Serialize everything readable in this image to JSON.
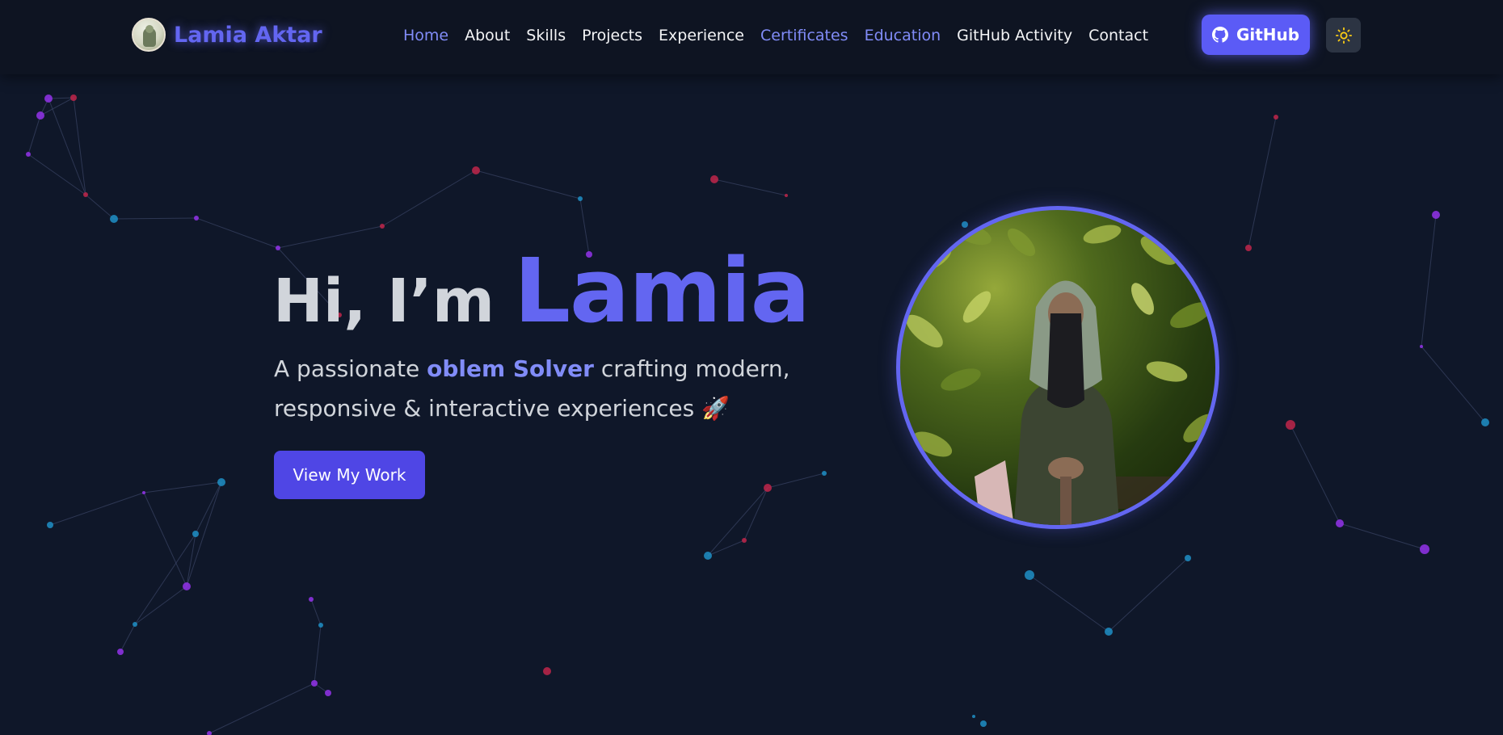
{
  "brand": {
    "name": "Lamia Aktar",
    "avatar_icon": "profile-avatar"
  },
  "nav": {
    "items": [
      {
        "label": "Home",
        "active": true
      },
      {
        "label": "About",
        "active": false
      },
      {
        "label": "Skills",
        "active": false
      },
      {
        "label": "Projects",
        "active": false
      },
      {
        "label": "Experience",
        "active": false
      },
      {
        "label": "Certificates",
        "active": true
      },
      {
        "label": "Education",
        "active": true
      },
      {
        "label": "GitHub Activity",
        "active": false
      },
      {
        "label": "Contact",
        "active": false
      }
    ],
    "github_button": {
      "label": "GitHub",
      "icon": "github-icon"
    },
    "theme_toggle": {
      "icon": "sun-icon"
    }
  },
  "hero": {
    "greeting": "Hi, I’m",
    "name": "Lamia",
    "tagline_prefix": "A passionate ",
    "tagline_highlight": "oblem Solver",
    "tagline_suffix": " crafting modern, responsive & interactive experiences ",
    "tagline_emoji": "🚀",
    "cta_label": "View My Work",
    "photo_icon": "profile-photo"
  },
  "colors": {
    "background": "#0f1729",
    "navbar": "#0e1422",
    "accent": "#6366f1",
    "accent_light": "#818cf8",
    "button": "#4f46e5",
    "text": "#d1d5db",
    "particle_red": "#c0264a",
    "particle_purple": "#9333ea",
    "particle_blue": "#1f8fc5"
  }
}
